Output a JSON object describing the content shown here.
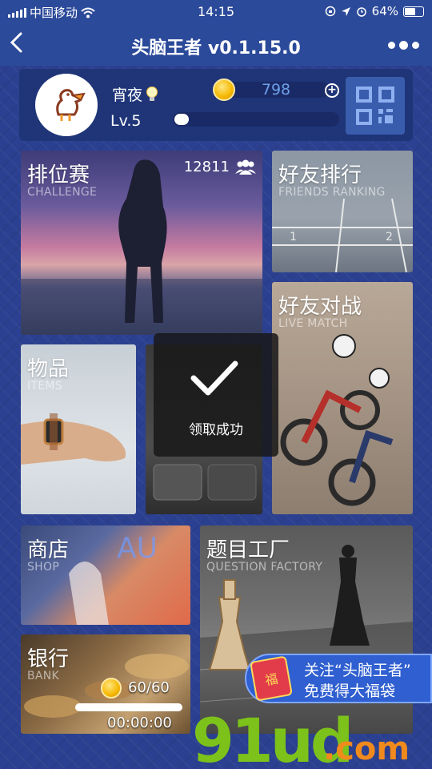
{
  "status_bar": {
    "carrier": "中国移动",
    "time": "14:15",
    "battery": "64%",
    "battery_fraction": 0.64
  },
  "nav": {
    "title": "头脑王者 v0.1.15.0",
    "back_icon": "chevron-left-icon",
    "more_icon": "more-dots-icon"
  },
  "profile": {
    "nickname": "宵夜",
    "level": "Lv.5",
    "coins": "798",
    "xp_fraction": 0.05
  },
  "tiles": {
    "challenge": {
      "title": "排位赛",
      "subtitle": "CHALLENGE",
      "players": "12811"
    },
    "friends_ranking": {
      "title": "好友排行",
      "subtitle": "FRIENDS RANKING"
    },
    "live_match": {
      "title": "好友对战",
      "subtitle": "LIVE MATCH"
    },
    "items": {
      "title": "物品",
      "subtitle": "ITEMS"
    },
    "shop": {
      "title": "商店",
      "subtitle": "SHOP"
    },
    "bank": {
      "title": "银行",
      "subtitle": "BANK",
      "count": "60/60",
      "timer": "00:00:00"
    },
    "question_factory": {
      "title": "题目工厂",
      "subtitle": "QUESTION FACTORY"
    }
  },
  "toast": {
    "text": "领取成功"
  },
  "promo": {
    "line1": "关注“头脑王者”",
    "line2": "免费得大福袋",
    "bag_char": "福"
  },
  "watermark": {
    "main": "91ud",
    "suffix": ".com"
  }
}
